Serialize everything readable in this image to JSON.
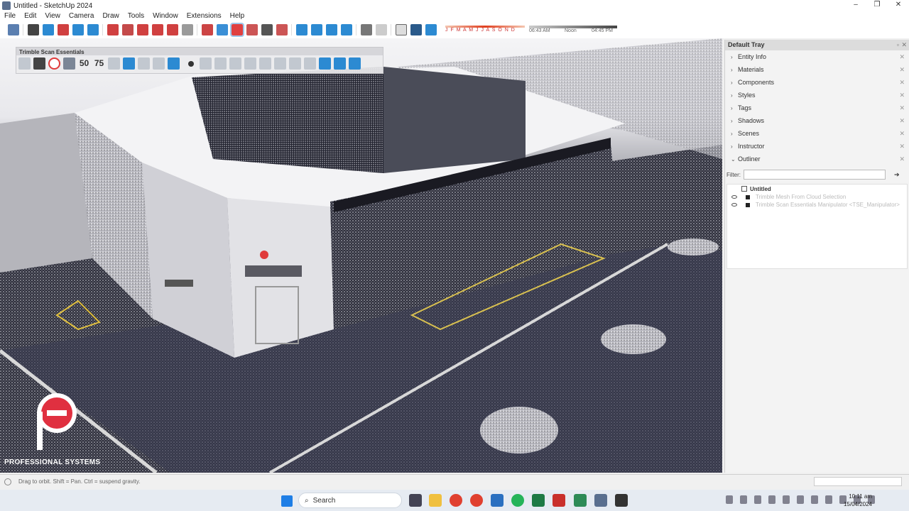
{
  "window": {
    "title": "Untitled - SketchUp 2024",
    "minimize": "–",
    "maximize": "❐",
    "close": "✕"
  },
  "menu": [
    "File",
    "Edit",
    "View",
    "Camera",
    "Draw",
    "Tools",
    "Window",
    "Extensions",
    "Help"
  ],
  "shadow": {
    "months": "J F M A M J J A S O N D",
    "time_start": "06:43 AM",
    "time_mid": "Noon",
    "time_end": "04:45 PM"
  },
  "tse_toolbar": {
    "title": "Trimble Scan Essentials",
    "label_50": "50",
    "label_75": "75"
  },
  "logo": {
    "line1": "PROFESSIONAL",
    "line2": "SYSTEMS"
  },
  "tray": {
    "title": "Default Tray",
    "panels": [
      "Entity Info",
      "Materials",
      "Components",
      "Styles",
      "Tags",
      "Shadows",
      "Scenes",
      "Instructor",
      "Outliner"
    ],
    "filter_label": "Filter:",
    "outliner_root": "Untitled",
    "outliner_items": [
      "Trimble Mesh From Cloud Selection",
      "Trimble Scan Essentials Manipulator <TSE_Manipulator>"
    ]
  },
  "status": {
    "hint": "Drag to orbit. Shift = Pan. Ctrl = suspend gravity."
  },
  "taskbar": {
    "search": "Search",
    "time": "10:11 am",
    "date": "15/04/2024"
  },
  "colors": {
    "accent": "#2c8ad2",
    "brand_red": "#e03040",
    "selection": "#e03b3b"
  }
}
